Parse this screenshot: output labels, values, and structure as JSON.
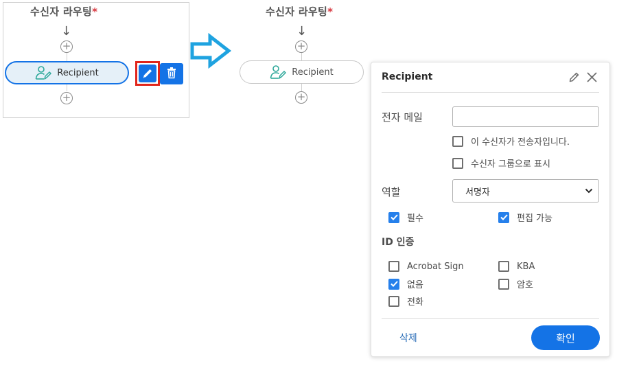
{
  "left": {
    "title": "수신자 라우팅",
    "required_mark": "*",
    "recipient_label": "Recipient",
    "arrow": "↓",
    "add": "+"
  },
  "right": {
    "title": "수신자 라우팅",
    "required_mark": "*",
    "recipient_label": "Recipient",
    "arrow": "↓",
    "add": "+"
  },
  "popup": {
    "title": "Recipient",
    "email_label": "전자 메일",
    "email_value": "",
    "sender_option": {
      "label": "이 수신자가 전송자입니다.",
      "checked": false
    },
    "group_option": {
      "label": "수신자 그룹으로 표시",
      "checked": false
    },
    "role_label": "역할",
    "role_value": "서명자",
    "required_option": {
      "label": "필수",
      "checked": true
    },
    "editable_option": {
      "label": "편집 가능",
      "checked": true
    },
    "id_auth_label": "ID 인증",
    "auth_options": [
      {
        "label": "Acrobat Sign",
        "checked": false
      },
      {
        "label": "KBA",
        "checked": false
      },
      {
        "label": "없음",
        "checked": true
      },
      {
        "label": "암호",
        "checked": false
      },
      {
        "label": "전화",
        "checked": false
      }
    ],
    "delete_label": "삭제",
    "confirm_label": "확인"
  },
  "colors": {
    "accent": "#1473e6",
    "checkbox": "#2680eb",
    "highlight_box": "#e1251b",
    "arrow": "#1fa3e0",
    "person_icon": "#2ea89a"
  },
  "icons": [
    "arrow-down-icon",
    "plus-circle-icon",
    "recipient-signer-icon",
    "pencil-icon",
    "trash-icon",
    "right-arrow-icon",
    "close-icon",
    "chevron-down-icon",
    "checkmark-icon"
  ]
}
